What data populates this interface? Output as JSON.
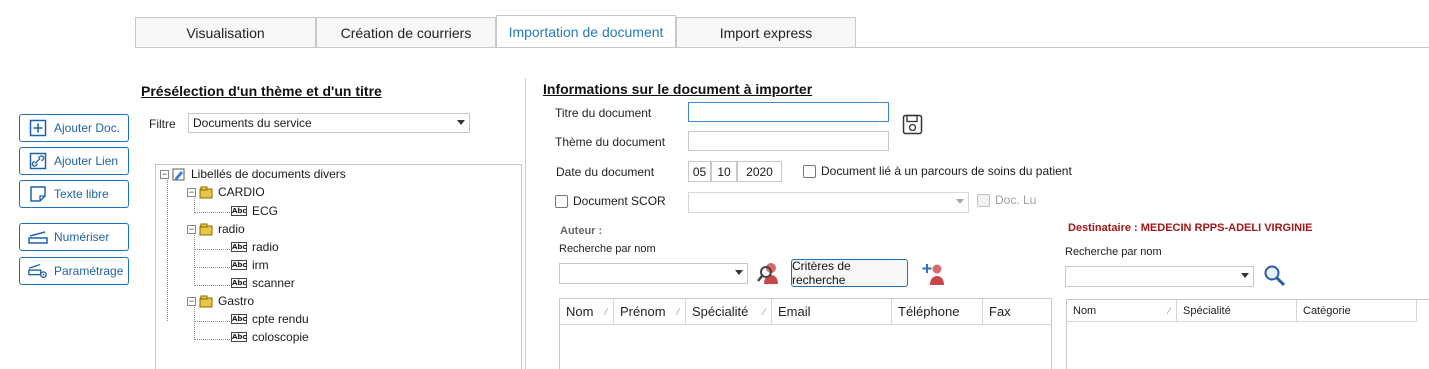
{
  "tabs": [
    {
      "label": "Visualisation"
    },
    {
      "label": "Création de courriers"
    },
    {
      "label": "Importation de document"
    },
    {
      "label": "Import express"
    }
  ],
  "side_buttons": {
    "add_doc": "Ajouter Doc.",
    "add_link": "Ajouter Lien",
    "free_text": "Texte libre",
    "scan": "Numériser",
    "settings": "Paramétrage"
  },
  "left_panel": {
    "heading": "Présélection d'un thème et d'un titre",
    "filter_label": "Filtre",
    "filter_value": "Documents du service",
    "tree": {
      "root": "Libellés de documents divers",
      "groups": [
        {
          "label": "CARDIO",
          "items": [
            "ECG"
          ]
        },
        {
          "label": "radio",
          "items": [
            "radio",
            "irm",
            "scanner"
          ]
        },
        {
          "label": "Gastro",
          "items": [
            "cpte rendu",
            "coloscopie"
          ]
        }
      ]
    }
  },
  "right_panel": {
    "heading": "Informations sur le document à importer",
    "title_label": "Titre du document",
    "title_value": "",
    "theme_label": "Thème du document",
    "theme_value": "",
    "date_label": "Date du document",
    "date_day": "05",
    "date_month": "10",
    "date_year": "2020",
    "care_path_label": "Document lié à un parcours de soins du patient",
    "scor_label": "Document SCOR",
    "doc_read_label": "Doc. Lu",
    "author": {
      "heading": "Auteur :",
      "search_label": "Recherche par nom",
      "criteria_button": "Critères de recherche",
      "columns": [
        "Nom",
        "Prénom",
        "Spécialité",
        "Email",
        "Téléphone",
        "Fax"
      ]
    },
    "recipient": {
      "heading": "Destinataire :  MEDECIN RPPS-ADELI VIRGINIE",
      "search_label": "Recherche par nom",
      "columns": [
        "Nom",
        "Spécialité",
        "Catégorie"
      ]
    }
  }
}
